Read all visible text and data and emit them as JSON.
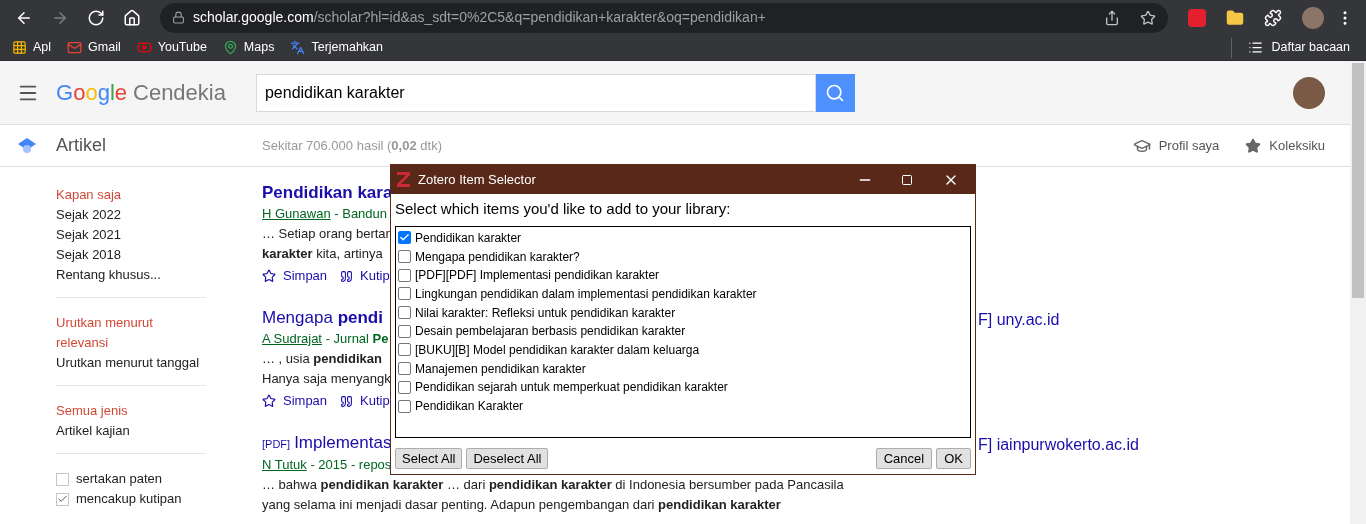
{
  "browser": {
    "nav": [
      {
        "kind": "back",
        "disabled": false
      },
      {
        "kind": "forward",
        "disabled": true
      },
      {
        "kind": "reload",
        "disabled": false
      },
      {
        "kind": "home",
        "disabled": false
      }
    ],
    "address": {
      "host": "scholar.google.com",
      "path": "/scholar?hl=id&as_sdt=0%2C5&q=pendidikan+karakter&oq=pendidikan+"
    },
    "bookmarks": [
      {
        "kind": "apps",
        "label": "Apl"
      },
      {
        "kind": "mail",
        "label": "Gmail"
      },
      {
        "kind": "video",
        "label": "YouTube"
      },
      {
        "kind": "map",
        "label": "Maps"
      },
      {
        "kind": "translate",
        "label": "Terjemahkan"
      }
    ],
    "reading_list": "Daftar bacaan"
  },
  "header": {
    "logo_google": "Google",
    "logo_product": "Cendekia",
    "search_value": "pendidikan karakter"
  },
  "subheader": {
    "section": "Artikel",
    "result_count": "Sekitar 706.000 hasil (**0,02** dtk)",
    "links": [
      "Profil saya",
      "Koleksiku"
    ]
  },
  "sidebar": {
    "groups": [
      {
        "items": [
          {
            "label": "Kapan saja",
            "selected": true
          },
          {
            "label": "Sejak 2022",
            "selected": false
          },
          {
            "label": "Sejak 2021",
            "selected": false
          },
          {
            "label": "Sejak 2018",
            "selected": false
          },
          {
            "label": "Rentang khusus...",
            "selected": false
          }
        ]
      },
      {
        "items": [
          {
            "label": "Urutkan menurut relevansi",
            "selected": true
          },
          {
            "label": "Urutkan menurut tanggal",
            "selected": false
          }
        ]
      },
      {
        "items": [
          {
            "label": "Semua jenis",
            "selected": true
          },
          {
            "label": "Artikel kajian",
            "selected": false
          }
        ]
      }
    ],
    "checks": [
      {
        "label": "sertakan paten",
        "checked": false
      },
      {
        "label": "mencakup kutipan",
        "checked": true
      }
    ]
  },
  "results": [
    {
      "title": "Pendidikan kara",
      "title_bold": true,
      "author": "H Gunawan",
      "source": "- Bandun",
      "snippet": [
        "… Setiap orang bertan",
        "**karakter** kita, artinya"
      ],
      "actions": [
        "Simpan",
        "Kutip"
      ]
    },
    {
      "title": "Mengapa **pendi**",
      "title_bold": false,
      "author": "A Sudrajat",
      "source": "- Jurnal **Pe**",
      "snippet": [
        "… , usia **pendidikan**",
        "Hanya saja menyangk"
      ],
      "actions": [
        "Simpan",
        "Kutip"
      ],
      "side": "F] uny.ac.id"
    },
    {
      "tag": "[PDF]",
      "title": "Implementas",
      "title_bold": false,
      "author": "N Tutuk",
      "source": "- 2015 - repos",
      "snippet": [
        "… bahwa **pendidikan karakter** … dari **pendidikan karakter** di Indonesia bersumber pada Pancasila",
        "yang selama ini menjadi dasar penting. Adapun pengembangan dari **pendidikan karakter**"
      ],
      "side": "F] iainpurwokerto.ac.id"
    }
  ],
  "dialog": {
    "title": "Zotero Item Selector",
    "prompt": "Select which items you'd like to add to your library:",
    "items": [
      {
        "label": "Pendidikan karakter",
        "checked": true
      },
      {
        "label": "Mengapa pendidikan karakter?",
        "checked": false
      },
      {
        "label": "[PDF][PDF] Implementasi pendidikan karakter",
        "checked": false
      },
      {
        "label": "Lingkungan pendidikan dalam implementasi pendidikan karakter",
        "checked": false
      },
      {
        "label": "Nilai karakter: Refleksi untuk pendidikan karakter",
        "checked": false
      },
      {
        "label": "Desain pembelajaran berbasis pendidikan karakter",
        "checked": false
      },
      {
        "label": "[BUKU][B] Model pendidikan karakter dalam keluarga",
        "checked": false
      },
      {
        "label": "Manajemen pendidikan karakter",
        "checked": false
      },
      {
        "label": "Pendidikan sejarah untuk memperkuat pendidikan karakter",
        "checked": false
      },
      {
        "label": "Pendidikan Karakter",
        "checked": false
      }
    ],
    "left_buttons": [
      "Select All",
      "Deselect All"
    ],
    "right_buttons": [
      "Cancel",
      "OK"
    ]
  }
}
